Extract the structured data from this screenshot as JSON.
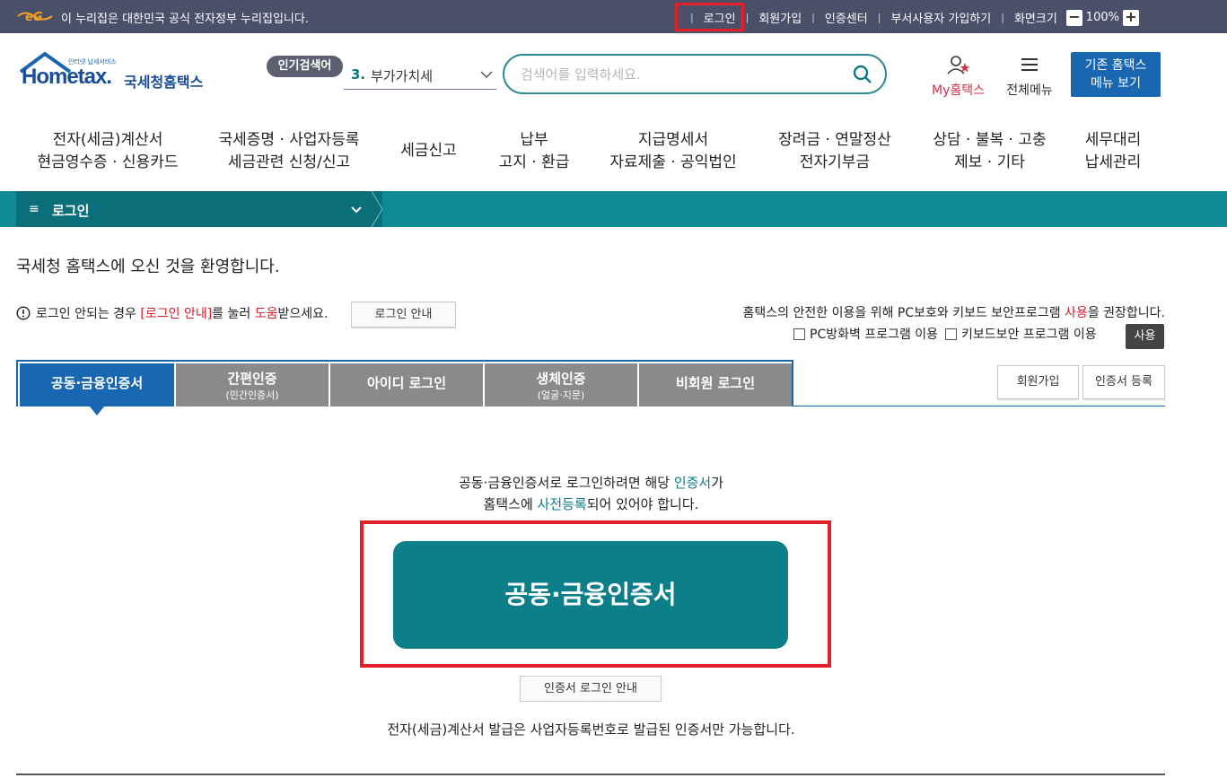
{
  "gov_bar": {
    "notice": "이 누리집은 대한민국 공식 전자정부 누리집입니다.",
    "links": [
      "로그인",
      "회원가입",
      "인증센터",
      "부서사용자 가입하기",
      "화면크기"
    ],
    "zoom_minus": "−",
    "zoom_value": "100%",
    "zoom_plus": "+"
  },
  "header": {
    "logo_small": "인터넷 납세서비스",
    "logo_text": "Hometax.",
    "logo_kr": "국세청홈택스",
    "popular_label": "인기검색어",
    "popular_num": "3.",
    "popular_term": "부가가치세",
    "search_placeholder": "검색어를 입력하세요.",
    "my_label": "My홈택스",
    "all_menu_label": "전체메뉴",
    "old_menu_line1": "기존 홈택스",
    "old_menu_line2": "메뉴 보기"
  },
  "gnb": [
    {
      "l1": "전자(세금)계산서",
      "l2": "현금영수증 · 신용카드"
    },
    {
      "l1": "국세증명 · 사업자등록",
      "l2": "세금관련 신청/신고"
    },
    {
      "l1": "세금신고",
      "l2": ""
    },
    {
      "l1": "납부",
      "l2": "고지 · 환급"
    },
    {
      "l1": "지급명세서",
      "l2": "자료제출 · 공익법인"
    },
    {
      "l1": "장려금 · 연말정산",
      "l2": "전자기부금"
    },
    {
      "l1": "상담 · 불복 · 고충",
      "l2": "제보 · 기타"
    },
    {
      "l1": "세무대리",
      "l2": "납세관리"
    }
  ],
  "breadcrumb": {
    "hamburger": "≡",
    "label": "로그인"
  },
  "welcome": "국세청 홈택스에 오신 것을 환영합니다.",
  "login_notice": {
    "pre": "로그인 안되는 경우 ",
    "red1": "[로그인 안내]",
    "mid": "를 눌러 ",
    "red2": "도움",
    "post": "받으세요.",
    "button": "로그인 안내"
  },
  "security": {
    "pre": "홈택스의 안전한 이용을 위해 PC보호와 키보드 보안프로그램 ",
    "red": "사용",
    "post": "을 권장합니다.",
    "opt1": "PC방화벽 프로그램 이용",
    "opt2": "키보드보안 프로그램 이용",
    "use_button": "사용"
  },
  "tabs": [
    {
      "main": "공동·금융인증서",
      "sub": ""
    },
    {
      "main": "간편인증",
      "sub": "(민간인증서)"
    },
    {
      "main": "아이디 로그인",
      "sub": ""
    },
    {
      "main": "생체인증",
      "sub": "(얼굴·지문)"
    },
    {
      "main": "비회원 로그인",
      "sub": ""
    }
  ],
  "right_buttons": {
    "signup": "회원가입",
    "cert_register": "인증서 등록"
  },
  "content": {
    "line1_pre": "공동·금융인증서로 로그인하려면 해당 ",
    "line1_teal": "인증서",
    "line1_post": "가",
    "line2_pre": "홈택스에 ",
    "line2_teal": "사전등록",
    "line2_post": "되어 있어야 합니다.",
    "cert_button": "공동·금융인증서",
    "cert_guide": "인증서 로그인 안내",
    "note": "전자(세금)계산서 발급은 사업자등록번호로 발급된 인증서만 가능합니다."
  },
  "colors": {
    "teal": "#0d7f89",
    "blue": "#1a67b1",
    "gov_bar": "#4a4f6a",
    "highlight": "#e3202a"
  }
}
